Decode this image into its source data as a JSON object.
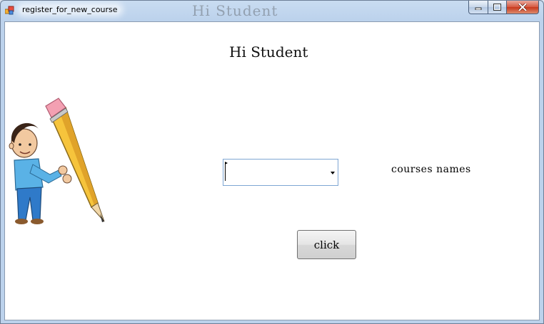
{
  "window": {
    "title": "register_for_new_course",
    "ghost_title": "Hi Student",
    "controls": {
      "minimize": "minimize",
      "maximize": "maximize",
      "close": "close"
    }
  },
  "form": {
    "heading": "Hi Student",
    "courses_combo": {
      "value": ""
    },
    "courses_label": "courses names",
    "click_button": "click"
  },
  "image": {
    "subject": "boy holding a giant pencil"
  }
}
